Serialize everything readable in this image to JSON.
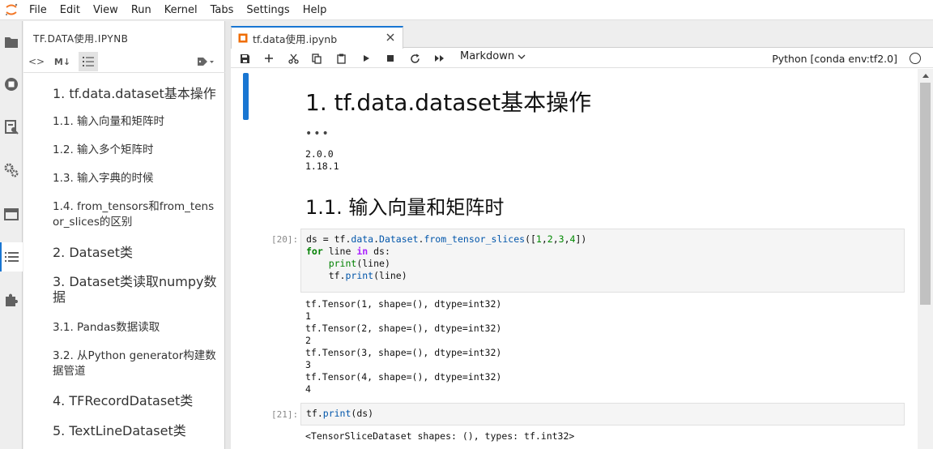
{
  "menubar": {
    "items": [
      "File",
      "Edit",
      "View",
      "Run",
      "Kernel",
      "Tabs",
      "Settings",
      "Help"
    ]
  },
  "sidebar": {
    "icons": [
      "folder-icon",
      "running-icon",
      "commands-icon",
      "property-inspector-icon",
      "tabs-icon",
      "toc-icon",
      "extension-icon"
    ]
  },
  "toc": {
    "title": "TF.DATA使用.IPYNB",
    "toolbar": [
      "<>",
      "M↓",
      "list",
      "tag"
    ],
    "items": [
      {
        "level": 1,
        "text": "1. tf.data.dataset基本操作"
      },
      {
        "level": 2,
        "text": "1.1. 输入向量和矩阵时"
      },
      {
        "level": 2,
        "text": "1.2. 输入多个矩阵时"
      },
      {
        "level": 2,
        "text": "1.3. 输入字典的时候"
      },
      {
        "level": 2,
        "text": "1.4. from_tensors和from_tensor_slices的区别"
      },
      {
        "level": 1,
        "text": "2. Dataset类"
      },
      {
        "level": 1,
        "text": "3. Dataset类读取numpy数据"
      },
      {
        "level": 2,
        "text": "3.1. Pandas数据读取"
      },
      {
        "level": 2,
        "text": "3.2. 从Python generator构建数据管道"
      },
      {
        "level": 1,
        "text": "4. TFRecordDataset类"
      },
      {
        "level": 1,
        "text": "5. TextLineDataset类"
      }
    ]
  },
  "tab": {
    "label": "tf.data使用.ipynb"
  },
  "notebook_toolbar": {
    "cell_type": "Markdown",
    "kernel": "Python [conda env:tf2.0]"
  },
  "cells": {
    "heading1": "1. tf.data.dataset基本操作",
    "ellipsis": "•••",
    "versions_output": "2.0.0\n1.18.1",
    "heading2": "1.1. 输入向量和矩阵时",
    "cell20": {
      "prompt": "[20]:",
      "code_lines": [
        "ds = tf.data.Dataset.from_tensor_slices([1,2,3,4])",
        "for line in ds:",
        "    print(line)",
        "    tf.print(line)"
      ],
      "output": "tf.Tensor(1, shape=(), dtype=int32)\n1\ntf.Tensor(2, shape=(), dtype=int32)\n2\ntf.Tensor(3, shape=(), dtype=int32)\n3\ntf.Tensor(4, shape=(), dtype=int32)\n4"
    },
    "cell21": {
      "prompt": "[21]:",
      "code": "tf.print(ds)",
      "output": "<TensorSliceDataset shapes: (), types: tf.int32>"
    }
  }
}
